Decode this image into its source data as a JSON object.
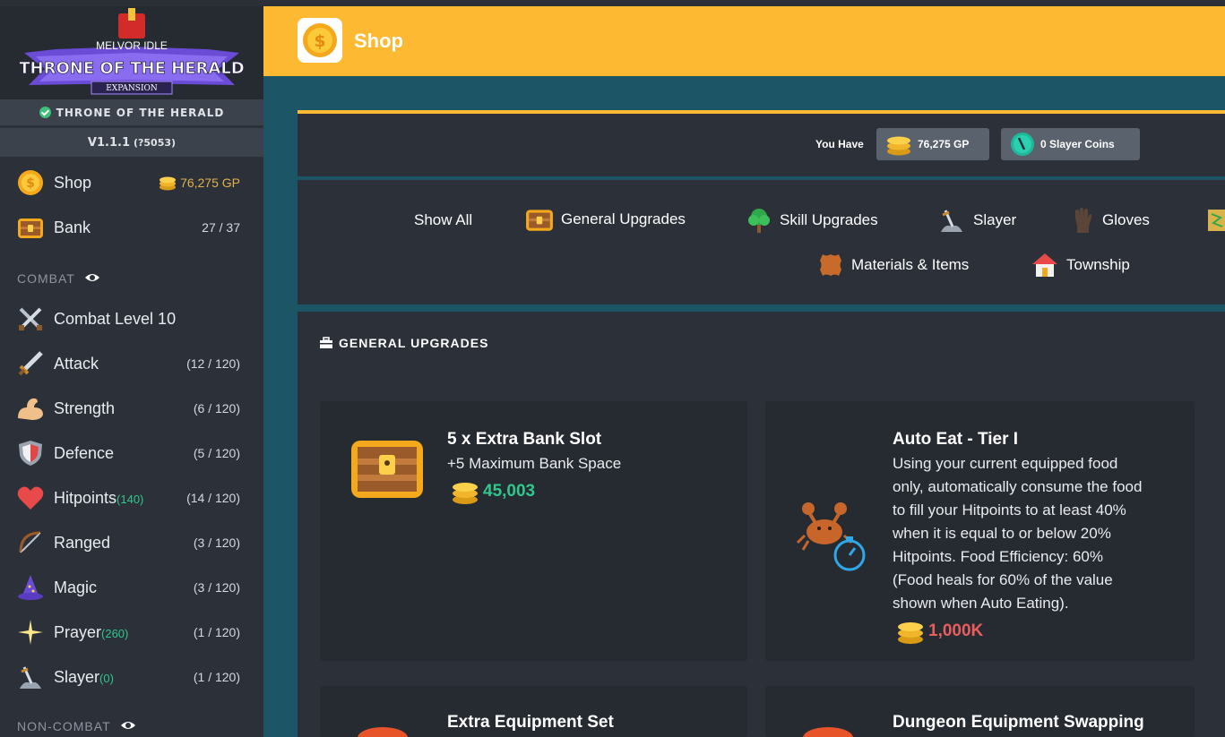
{
  "sidebar": {
    "logo": {
      "top": "MELVOR IDLE",
      "main": "THRONE OF THE HERALD",
      "sub": "EXPANSION"
    },
    "expansion_label": "THRONE OF THE HERALD",
    "version": "V1.1.1",
    "build": "(?5053)",
    "top_items": [
      {
        "label": "Shop",
        "right": "76,275 GP"
      },
      {
        "label": "Bank",
        "right": "27 / 37"
      }
    ],
    "combat_title": "COMBAT",
    "combat_items": [
      {
        "label": "Combat Level 10",
        "sub": "",
        "right": ""
      },
      {
        "label": "Attack",
        "sub": "",
        "right": "(12 / 120)"
      },
      {
        "label": "Strength",
        "sub": "",
        "right": "(6 / 120)"
      },
      {
        "label": "Defence",
        "sub": "",
        "right": "(5 / 120)"
      },
      {
        "label": "Hitpoints",
        "sub": "(140)",
        "right": "(14 / 120)"
      },
      {
        "label": "Ranged",
        "sub": "",
        "right": "(3 / 120)"
      },
      {
        "label": "Magic",
        "sub": "",
        "right": "(3 / 120)"
      },
      {
        "label": "Prayer",
        "sub": "(260)",
        "right": "(1 / 120)"
      },
      {
        "label": "Slayer",
        "sub": "(0)",
        "right": "(1 / 120)"
      }
    ],
    "noncombat_title": "NON-COMBAT"
  },
  "header": {
    "title": "Shop"
  },
  "currency": {
    "label": "You Have",
    "gp": "76,275 GP",
    "slayer": "0 Slayer Coins"
  },
  "categories": [
    "Show All",
    "General Upgrades",
    "Skill Upgrades",
    "Slayer",
    "Gloves",
    "Materials & Items",
    "Township"
  ],
  "main": {
    "title": "GENERAL UPGRADES",
    "cards": [
      {
        "name": "5 x Extra Bank Slot",
        "desc": "+5 Maximum Bank Space",
        "cost": "45,003"
      },
      {
        "name": "Auto Eat - Tier I",
        "desc": [
          "Using your current equipped food",
          "only, automatically consume the food",
          "to fill your Hitpoints to at least 40%",
          "when it is equal to or below 20%",
          "Hitpoints. Food Efficiency: 60%",
          "(Food heals for 60% of the value",
          "shown when Auto Eating)."
        ],
        "cost": "1,000K"
      },
      {
        "name": "Extra Equipment Set"
      },
      {
        "name": "Dungeon Equipment Swapping"
      }
    ]
  },
  "colors": {
    "accent": "#fdb931",
    "sidebar": "#2b3039",
    "affordable": "#30c78d",
    "unaffordable": "#e85d5d"
  }
}
